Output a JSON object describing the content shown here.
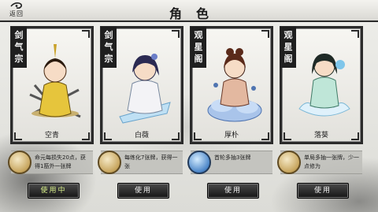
{
  "header": {
    "back_label": "返回",
    "title": "角色"
  },
  "characters": [
    {
      "sect": [
        "剑",
        "气",
        "宗"
      ],
      "name": "空青",
      "description": "命元每损失20点，获得1筋外一张牌",
      "button": "使用中",
      "icon": "scroll-icon",
      "robe_color": "#e6c53c"
    },
    {
      "sect": [
        "剑",
        "气",
        "宗"
      ],
      "name": "白薇",
      "description": "每练化7张牌，获得一张",
      "button": "使用",
      "icon": "book-icon",
      "robe_color": "#f3f3f6"
    },
    {
      "sect": [
        "观",
        "星",
        "阁"
      ],
      "name": "厚朴",
      "description": "首轮多抽3张牌",
      "button": "使用",
      "icon": "star-chart-icon",
      "robe_color": "#e3b8a0"
    },
    {
      "sect": [
        "观",
        "星",
        "阁"
      ],
      "name": "落葵",
      "description": "单局多抽一张牌，少一点修为",
      "button": "使用",
      "icon": "coin-icon",
      "robe_color": "#bfe6d8"
    }
  ]
}
